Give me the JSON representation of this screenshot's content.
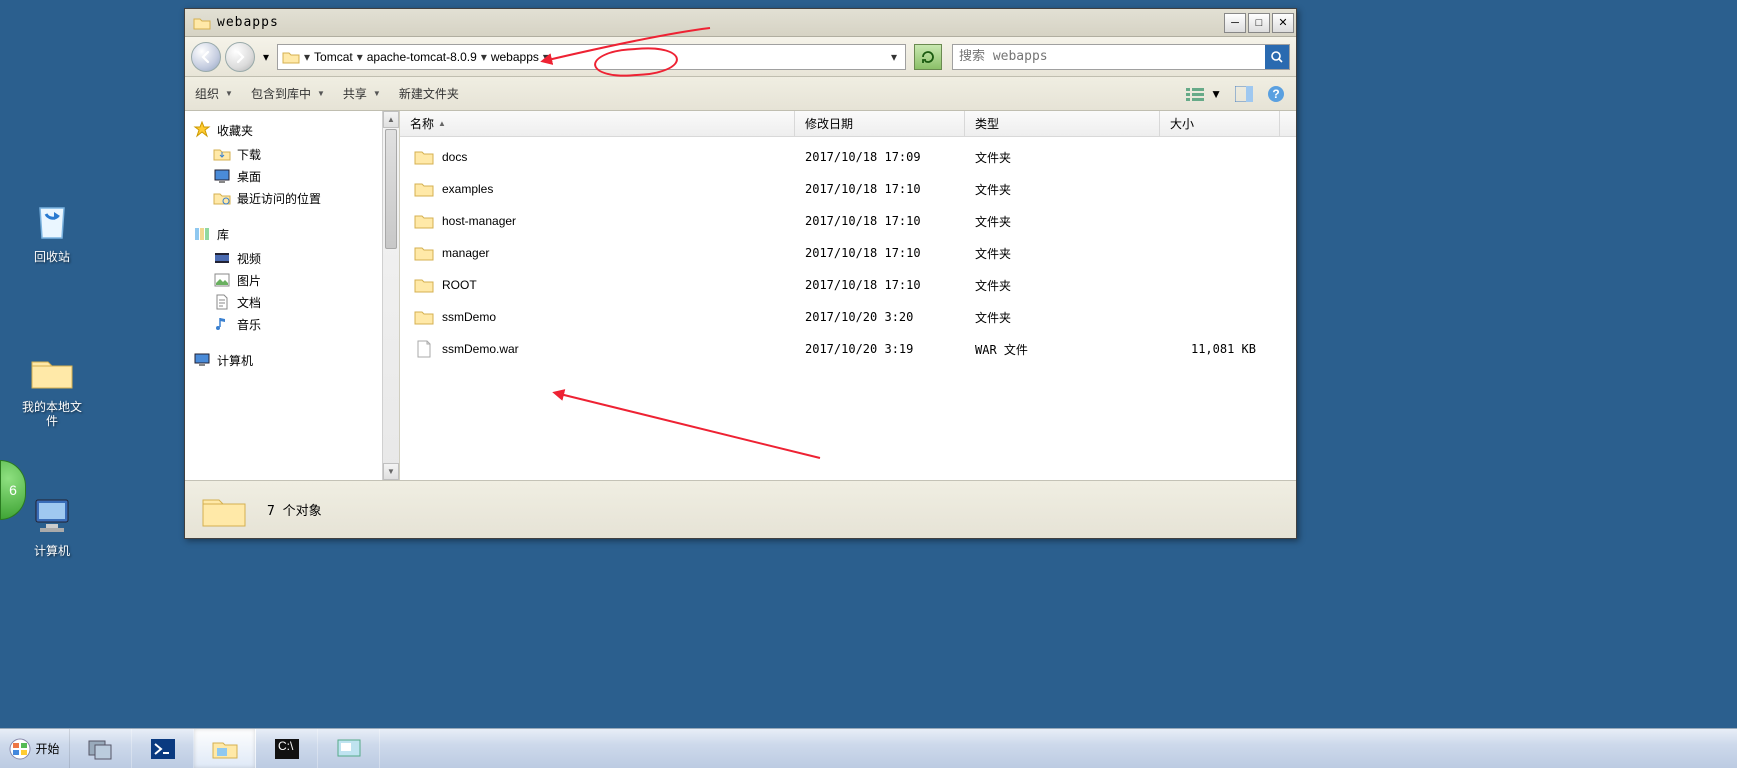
{
  "desktop": {
    "recycle": "回收站",
    "myfiles": "我的本地文\n件",
    "computer": "计算机"
  },
  "window": {
    "title": "webapps",
    "breadcrumb": [
      "Tomcat",
      "apache-tomcat-8.0.9",
      "webapps"
    ],
    "search_placeholder": "搜索 webapps",
    "toolbar": {
      "organize": "组织",
      "include": "包含到库中",
      "share": "共享",
      "newfolder": "新建文件夹"
    },
    "sidebar": {
      "fav_title": "收藏夹",
      "fav": [
        "下载",
        "桌面",
        "最近访问的位置"
      ],
      "lib_title": "库",
      "lib": [
        "视频",
        "图片",
        "文档",
        "音乐"
      ],
      "computer_title": "计算机"
    },
    "columns": {
      "name": "名称",
      "date": "修改日期",
      "type": "类型",
      "size": "大小"
    },
    "rows": [
      {
        "name": "docs",
        "date": "2017/10/18 17:09",
        "type": "文件夹",
        "size": "",
        "kind": "folder"
      },
      {
        "name": "examples",
        "date": "2017/10/18 17:10",
        "type": "文件夹",
        "size": "",
        "kind": "folder"
      },
      {
        "name": "host-manager",
        "date": "2017/10/18 17:10",
        "type": "文件夹",
        "size": "",
        "kind": "folder"
      },
      {
        "name": "manager",
        "date": "2017/10/18 17:10",
        "type": "文件夹",
        "size": "",
        "kind": "folder"
      },
      {
        "name": "ROOT",
        "date": "2017/10/18 17:10",
        "type": "文件夹",
        "size": "",
        "kind": "folder"
      },
      {
        "name": "ssmDemo",
        "date": "2017/10/20 3:20",
        "type": "文件夹",
        "size": "",
        "kind": "folder"
      },
      {
        "name": "ssmDemo.war",
        "date": "2017/10/20 3:19",
        "type": "WAR 文件",
        "size": "11,081 KB",
        "kind": "file"
      }
    ],
    "status": "7 个对象"
  },
  "taskbar": {
    "start": "开始"
  },
  "clock_badge": "6"
}
